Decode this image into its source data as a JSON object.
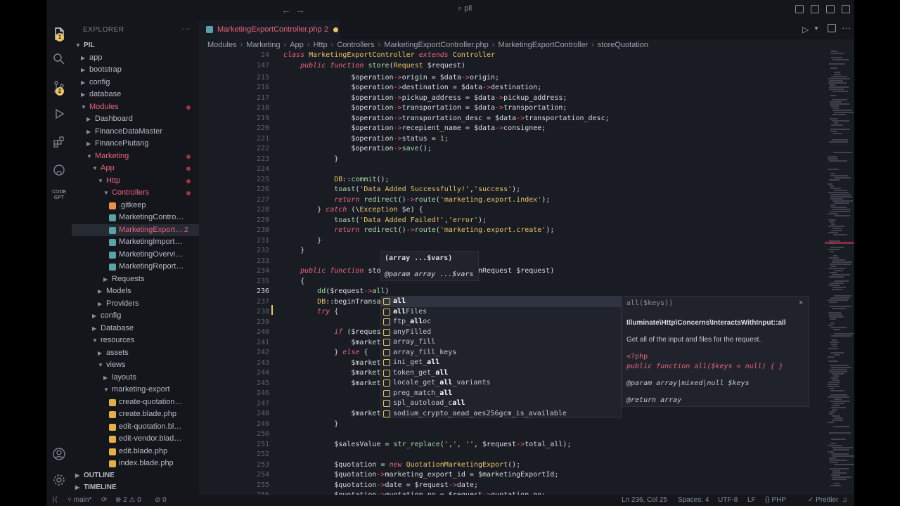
{
  "window": {
    "search_text": "pil",
    "accent": "#e8637a",
    "modified_dot_color": "#e9c46a"
  },
  "activity_bar": {
    "items": [
      {
        "name": "explorer-icon",
        "badge": "1"
      },
      {
        "name": "search-icon",
        "badge": ""
      },
      {
        "name": "source-control-icon",
        "badge": "2"
      },
      {
        "name": "run-debug-icon",
        "badge": ""
      },
      {
        "name": "extensions-icon",
        "badge": ""
      },
      {
        "name": "github-icon",
        "badge": ""
      },
      {
        "name": "codegpt-icon",
        "badge": ""
      }
    ],
    "bottom": [
      {
        "name": "account-icon"
      },
      {
        "name": "settings-icon"
      }
    ]
  },
  "sidebar": {
    "title": "EXPLORER",
    "more": "···",
    "root": "PIL",
    "items": [
      {
        "label": "app",
        "depth": 1,
        "kind": "folder-closed",
        "state": "normal"
      },
      {
        "label": "bootstrap",
        "depth": 1,
        "kind": "folder-closed",
        "state": "normal"
      },
      {
        "label": "config",
        "depth": 1,
        "kind": "folder-closed",
        "state": "normal"
      },
      {
        "label": "database",
        "depth": 1,
        "kind": "folder-closed",
        "state": "normal"
      },
      {
        "label": "Modules",
        "depth": 1,
        "kind": "folder-open",
        "state": "modified"
      },
      {
        "label": "Dashboard",
        "depth": 2,
        "kind": "folder-closed",
        "state": "normal"
      },
      {
        "label": "FinanceDataMaster",
        "depth": 2,
        "kind": "folder-closed",
        "state": "normal"
      },
      {
        "label": "FinancePiutang",
        "depth": 2,
        "kind": "folder-closed",
        "state": "normal"
      },
      {
        "label": "Marketing",
        "depth": 2,
        "kind": "folder-open",
        "state": "modified"
      },
      {
        "label": "App",
        "depth": 3,
        "kind": "folder-open",
        "state": "modified"
      },
      {
        "label": "Http",
        "depth": 4,
        "kind": "folder-open",
        "state": "modified"
      },
      {
        "label": "Controllers",
        "depth": 5,
        "kind": "folder-open",
        "state": "modified"
      },
      {
        "label": ".gitkeep",
        "depth": 6,
        "kind": "file-git",
        "state": "normal"
      },
      {
        "label": "MarketingController.php",
        "depth": 6,
        "kind": "file-php",
        "state": "normal"
      },
      {
        "label": "MarketingExportC...",
        "depth": 6,
        "kind": "file-php",
        "state": "selected",
        "count": "2"
      },
      {
        "label": "MarketingImportContr...",
        "depth": 6,
        "kind": "file-php",
        "state": "normal"
      },
      {
        "label": "MarketingOverviewCo...",
        "depth": 6,
        "kind": "file-php",
        "state": "normal"
      },
      {
        "label": "MarketingReportContr...",
        "depth": 6,
        "kind": "file-php",
        "state": "normal"
      },
      {
        "label": "Requests",
        "depth": 5,
        "kind": "folder-closed",
        "state": "normal"
      },
      {
        "label": "Models",
        "depth": 4,
        "kind": "folder-closed",
        "state": "normal"
      },
      {
        "label": "Providers",
        "depth": 4,
        "kind": "folder-closed",
        "state": "normal"
      },
      {
        "label": "config",
        "depth": 3,
        "kind": "folder-closed",
        "state": "normal"
      },
      {
        "label": "Database",
        "depth": 3,
        "kind": "folder-closed",
        "state": "normal"
      },
      {
        "label": "resources",
        "depth": 3,
        "kind": "folder-open",
        "state": "normal"
      },
      {
        "label": "assets",
        "depth": 4,
        "kind": "folder-closed",
        "state": "normal"
      },
      {
        "label": "views",
        "depth": 4,
        "kind": "folder-open",
        "state": "normal"
      },
      {
        "label": "layouts",
        "depth": 5,
        "kind": "folder-closed",
        "state": "normal"
      },
      {
        "label": "marketing-export",
        "depth": 5,
        "kind": "folder-open",
        "state": "normal"
      },
      {
        "label": "create-quotation.blade...",
        "depth": 6,
        "kind": "file-blade",
        "state": "normal"
      },
      {
        "label": "create.blade.php",
        "depth": 6,
        "kind": "file-blade",
        "state": "normal"
      },
      {
        "label": "edit-quotation.blade.php",
        "depth": 6,
        "kind": "file-blade",
        "state": "normal"
      },
      {
        "label": "edit-vendor.blade.php",
        "depth": 6,
        "kind": "file-blade",
        "state": "normal"
      },
      {
        "label": "edit.blade.php",
        "depth": 6,
        "kind": "file-blade",
        "state": "normal"
      },
      {
        "label": "index.blade.php",
        "depth": 6,
        "kind": "file-blade",
        "state": "normal"
      }
    ],
    "outline": "OUTLINE",
    "timeline": "TIMELINE"
  },
  "editor": {
    "tab": {
      "label": "MarketingExportController.php",
      "problems": "2"
    },
    "breadcrumb": [
      "Modules",
      "Marketing",
      "App",
      "Http",
      "Controllers",
      "MarketingExportController.php",
      "MarketingExportController",
      "storeQuotation"
    ],
    "sticky": [
      {
        "ln": "24",
        "code": "class MarketingExportController extends Controller"
      },
      {
        "ln": "147",
        "code": "    public function store(Request $request)"
      }
    ],
    "lines": [
      {
        "ln": "215",
        "code": "                $operation->origin = $data->origin;"
      },
      {
        "ln": "216",
        "code": "                $operation->destination = $data->destination;"
      },
      {
        "ln": "217",
        "code": "                $operation->pickup_address = $data->pickup_address;"
      },
      {
        "ln": "218",
        "code": "                $operation->transportation = $data->transportation;"
      },
      {
        "ln": "219",
        "code": "                $operation->transportation_desc = $data->transportation_desc;"
      },
      {
        "ln": "220",
        "code": "                $operation->recepient_name = $data->consignee;"
      },
      {
        "ln": "221",
        "code": "                $operation->status = 1;"
      },
      {
        "ln": "222",
        "code": "                $operation->save();"
      },
      {
        "ln": "223",
        "code": "            }"
      },
      {
        "ln": "224",
        "code": ""
      },
      {
        "ln": "225",
        "code": "            DB::commit();"
      },
      {
        "ln": "226",
        "code": "            toast('Data Added Successfully!','success');"
      },
      {
        "ln": "227",
        "code": "            return redirect()->route('marketing.export.index');"
      },
      {
        "ln": "228",
        "code": "        } catch (\\Exception $e) {"
      },
      {
        "ln": "229",
        "code": "            toast('Data Added Failed!','error');"
      },
      {
        "ln": "230",
        "code": "            return redirect()->route('marketing.export.create');"
      },
      {
        "ln": "231",
        "code": "        }"
      },
      {
        "ln": "232",
        "code": "    }"
      },
      {
        "ln": "233",
        "code": ""
      },
      {
        "ln": "234",
        "code": "    public function stor                    ionRequest $request)"
      },
      {
        "ln": "235",
        "code": "    {"
      },
      {
        "ln": "236",
        "code": "        dd($request->all)"
      },
      {
        "ln": "237",
        "code": "        DB::beginTransac"
      },
      {
        "ln": "238",
        "code": "        try {"
      },
      {
        "ln": "239",
        "code": ""
      },
      {
        "ln": "240",
        "code": "            if ($request"
      },
      {
        "ln": "241",
        "code": "                $marketi"
      },
      {
        "ln": "242",
        "code": "            } else {"
      },
      {
        "ln": "243",
        "code": "                $marketi"
      },
      {
        "ln": "244",
        "code": "                $marketi"
      },
      {
        "ln": "245",
        "code": "                $marketi"
      },
      {
        "ln": "246",
        "code": ""
      },
      {
        "ln": "247",
        "code": ""
      },
      {
        "ln": "248",
        "code": "                $marketi"
      },
      {
        "ln": "249",
        "code": "            }"
      },
      {
        "ln": "250",
        "code": ""
      },
      {
        "ln": "251",
        "code": "            $salesValue = str_replace(',', '', $request->total_all);"
      },
      {
        "ln": "252",
        "code": ""
      },
      {
        "ln": "253",
        "code": "            $quotation = new QuotationMarketingExport();"
      },
      {
        "ln": "254",
        "code": "            $quotation->marketing_export_id = $marketingExportId;"
      },
      {
        "ln": "255",
        "code": "            $quotation->date = $request->date;"
      },
      {
        "ln": "256",
        "code": "            $quotation->quotation_no = $request->quotation_no;"
      }
    ],
    "current_line": "236",
    "hover": {
      "signature": "(array ...$vars)",
      "param": "@param array ...$vars"
    },
    "suggestions": [
      "all",
      "allFiles",
      "ftp_alloc",
      "anyFilled",
      "array_fill",
      "array_fill_keys",
      "ini_get_all",
      "token_get_all",
      "locale_get_all_variants",
      "preg_match_all",
      "spl_autoload_call",
      "sodium_crypto_aead_aes256gcm_is_available"
    ],
    "details": {
      "signature": "all($keys))",
      "namespace": "Illuminate\\Http\\Concerns\\InteractsWithInput::all",
      "description": "Get all of the input and files for the request.",
      "php_open": "<?php",
      "code": "public function all($keys = null) { }",
      "param": "@param array|mixed|null $keys",
      "return": "@return array",
      "close": "×"
    }
  },
  "statusbar": {
    "branch": "main*",
    "sync": "",
    "errors": "2",
    "warnings": "0",
    "ports": "0",
    "position": "Ln 236, Col 25",
    "spaces": "Spaces: 4",
    "encoding": "UTF-8",
    "eol": "LF",
    "language": "PHP",
    "formatter": "Prettier"
  }
}
